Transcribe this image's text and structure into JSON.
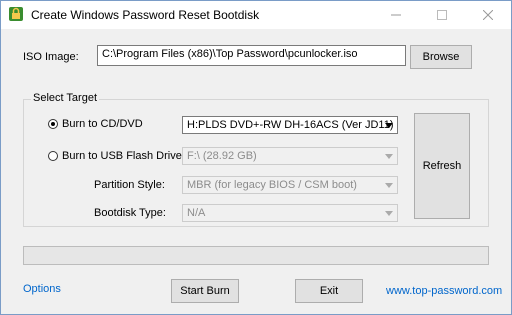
{
  "window": {
    "title": "Create Windows Password Reset Bootdisk",
    "minimize_icon": "minimize-icon",
    "maximize_icon": "maximize-icon",
    "close_icon": "close-icon"
  },
  "iso": {
    "label": "ISO Image:",
    "path": "C:\\Program Files (x86)\\Top Password\\pcunlocker.iso",
    "browse_label": "Browse"
  },
  "target": {
    "group_label": "Select Target",
    "cd": {
      "label": "Burn to CD/DVD",
      "checked": true,
      "drive": "H:PLDS DVD+-RW DH-16ACS (Ver JD11)"
    },
    "usb": {
      "label": "Burn to USB Flash Drive",
      "checked": false,
      "drive": "F:\\ (28.92 GB)",
      "partition_label": "Partition Style:",
      "partition_value": "MBR (for legacy BIOS / CSM boot)",
      "bootdisk_label": "Bootdisk Type:",
      "bootdisk_value": "N/A"
    },
    "refresh_label": "Refresh"
  },
  "progress": {
    "value": 0
  },
  "footer": {
    "options_label": "Options",
    "start_label": "Start Burn",
    "exit_label": "Exit",
    "website": "www.top-password.com"
  },
  "colors": {
    "link": "#0066cc",
    "window_bg": "#f0f0f0",
    "button_bg": "#e1e1e1"
  }
}
